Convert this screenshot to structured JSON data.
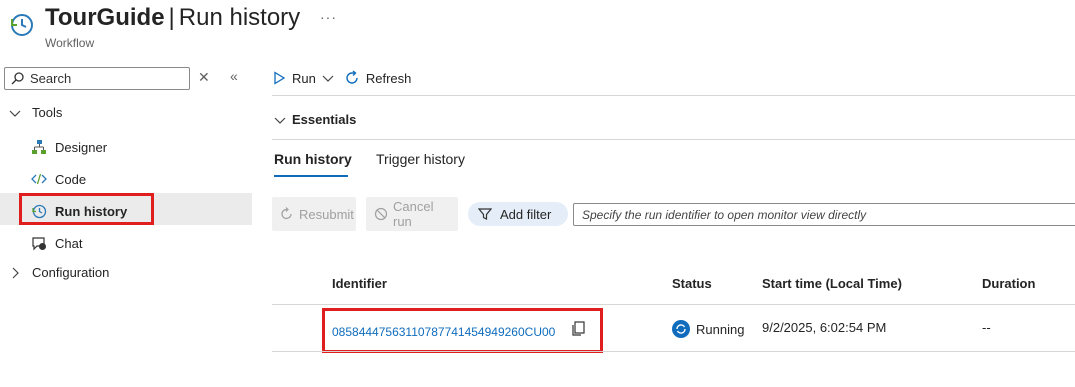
{
  "header": {
    "app_name": "TourGuide",
    "separator": "|",
    "page_name": "Run history",
    "subtitle": "Workflow",
    "more_label": "···"
  },
  "sidebar": {
    "search_placeholder": "Search",
    "close_label": "✕",
    "collapse_label": "«",
    "groups": [
      {
        "label": "Tools",
        "expanded": true,
        "items": [
          {
            "label": "Designer",
            "icon": "designer-icon"
          },
          {
            "label": "Code",
            "icon": "code-icon"
          },
          {
            "label": "Run history",
            "icon": "history-icon",
            "selected": true
          },
          {
            "label": "Chat",
            "icon": "chat-icon"
          }
        ]
      },
      {
        "label": "Configuration",
        "expanded": false
      }
    ]
  },
  "toolbar": {
    "run_label": "Run",
    "refresh_label": "Refresh"
  },
  "essentials": {
    "label": "Essentials"
  },
  "tabs": [
    {
      "label": "Run history",
      "active": true
    },
    {
      "label": "Trigger history",
      "active": false
    }
  ],
  "actions": {
    "resubmit_label": "Resubmit",
    "cancel_label": "Cancel run",
    "add_filter_label": "Add filter",
    "filter_placeholder": "Specify the run identifier to open monitor view directly"
  },
  "table": {
    "columns": [
      "Identifier",
      "Status",
      "Start time (Local Time)",
      "Duration"
    ],
    "rows": [
      {
        "identifier": "08584447563110787741454949260CU00",
        "status": "Running",
        "start_time": "9/2/2025, 6:02:54 PM",
        "duration": "--"
      }
    ]
  },
  "colors": {
    "accent": "#0f6cbd",
    "highlight_box": "#e01e1e",
    "selected_bg": "#ebebeb"
  }
}
